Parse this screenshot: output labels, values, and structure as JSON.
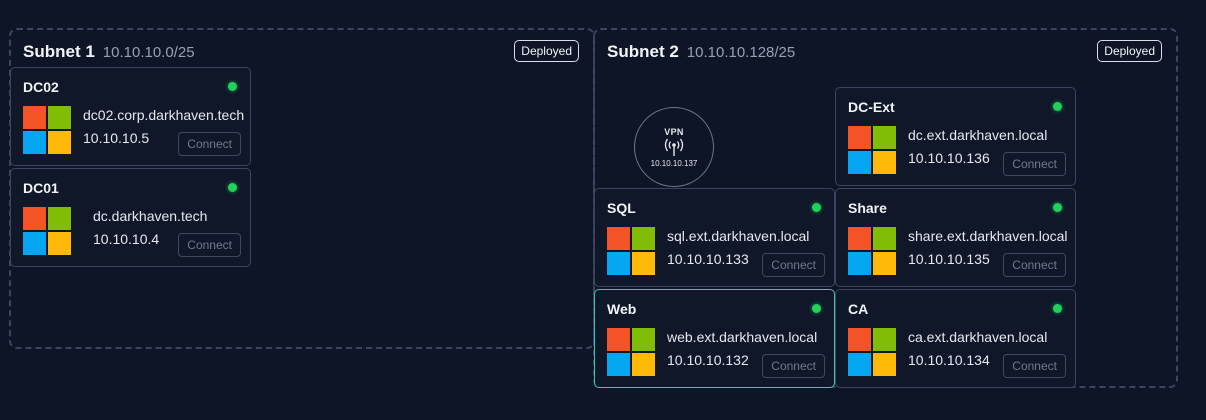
{
  "subnets": [
    {
      "name": "Subnet 1",
      "cidr": "10.10.10.0/25",
      "badge": "Deployed"
    },
    {
      "name": "Subnet 2",
      "cidr": "10.10.10.128/25",
      "badge": "Deployed"
    }
  ],
  "vpn": {
    "label": "VPN",
    "ip": "10.10.10.137",
    "icon": "antenna-icon"
  },
  "hosts": [
    {
      "name": "DC02",
      "hostname": "dc02.corp.darkhaven.tech",
      "ip": "10.10.10.5",
      "os_icon": "windows-logo-icon",
      "status": "online",
      "connect_label": "Connect"
    },
    {
      "name": "DC01",
      "hostname": "dc.darkhaven.tech",
      "ip": "10.10.10.4",
      "os_icon": "windows-logo-icon",
      "status": "online",
      "connect_label": "Connect"
    },
    {
      "name": "DC-Ext",
      "hostname": "dc.ext.darkhaven.local",
      "ip": "10.10.10.136",
      "os_icon": "windows-logo-icon",
      "status": "online",
      "connect_label": "Connect"
    },
    {
      "name": "SQL",
      "hostname": "sql.ext.darkhaven.local",
      "ip": "10.10.10.133",
      "os_icon": "windows-logo-icon",
      "status": "online",
      "connect_label": "Connect"
    },
    {
      "name": "Share",
      "hostname": "share.ext.darkhaven.local",
      "ip": "10.10.10.135",
      "os_icon": "windows-logo-icon",
      "status": "online",
      "connect_label": "Connect"
    },
    {
      "name": "Web",
      "hostname": "web.ext.darkhaven.local",
      "ip": "10.10.10.132",
      "os_icon": "windows-logo-icon",
      "status": "online",
      "connect_label": "Connect",
      "selected": true
    },
    {
      "name": "CA",
      "hostname": "ca.ext.darkhaven.local",
      "ip": "10.10.10.134",
      "os_icon": "windows-logo-icon",
      "status": "online",
      "connect_label": "Connect"
    }
  ],
  "colors": {
    "background": "#0d1526",
    "card_border": "#3a4660",
    "selected_border": "#38c9b2",
    "status_online": "#22d05a",
    "win_red": "#f35325",
    "win_green": "#81bc06",
    "win_blue": "#05a6f0",
    "win_yellow": "#ffba08"
  }
}
